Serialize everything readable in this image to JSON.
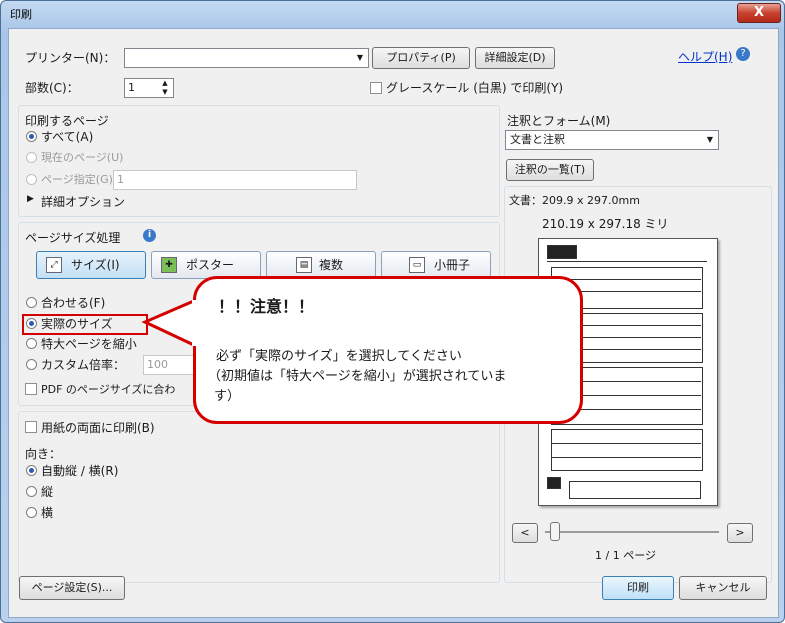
{
  "window": {
    "title": "印刷",
    "close_label": "X"
  },
  "printer": {
    "label": "プリンター(N)：",
    "value": "",
    "properties_label": "プロパティ(P)",
    "advanced_label": "詳細設定(D)",
    "help_label": "ヘルプ(H)"
  },
  "copies": {
    "label": "部数(C)：",
    "value": "1"
  },
  "grayscale": {
    "label": "グレースケール (白黒) で印刷(Y)",
    "checked": false
  },
  "pages": {
    "title": "印刷するページ",
    "all": "すべて(A)",
    "current": "現在のページ(U)",
    "range": "ページ指定(G)",
    "range_value": "1",
    "more": "詳細オプション"
  },
  "sizing": {
    "title": "ページサイズ処理",
    "buttons": [
      "サイズ(I)",
      "ポスター",
      "複数",
      "小冊子"
    ],
    "fit": "合わせる(F)",
    "actual": "実際のサイズ",
    "shrink": "特大ページを縮小",
    "custom": "カスタム倍率：",
    "custom_value": "100",
    "pdf_size": "PDF のページサイズに合わ"
  },
  "duplex": {
    "label": "用紙の両面に印刷(B)"
  },
  "orientation": {
    "title": "向き：",
    "auto": "自動縦 / 横(R)",
    "portrait": "縦",
    "landscape": "横"
  },
  "comments": {
    "title": "注釈とフォーム(M)",
    "value": "文書と注釈",
    "summarize": "注釈の一覧(T)"
  },
  "preview": {
    "doc_label": "文書：209.9 x 297.0mm",
    "size_label": "210.19 x 297.18 ミリ",
    "page_label": "1 / 1 ページ"
  },
  "callout": {
    "heading": "！！注意！！",
    "line1": "必ず「実際のサイズ」を選択してください",
    "line2": "（初期値は「特大ページを縮小」が選択されていま",
    "line3": "す）"
  },
  "footer": {
    "page_setup": "ページ設定(S)...",
    "print": "印刷",
    "cancel": "キャンセル"
  },
  "colors": {
    "callout_border": "#d40000",
    "link": "#0033cc"
  }
}
